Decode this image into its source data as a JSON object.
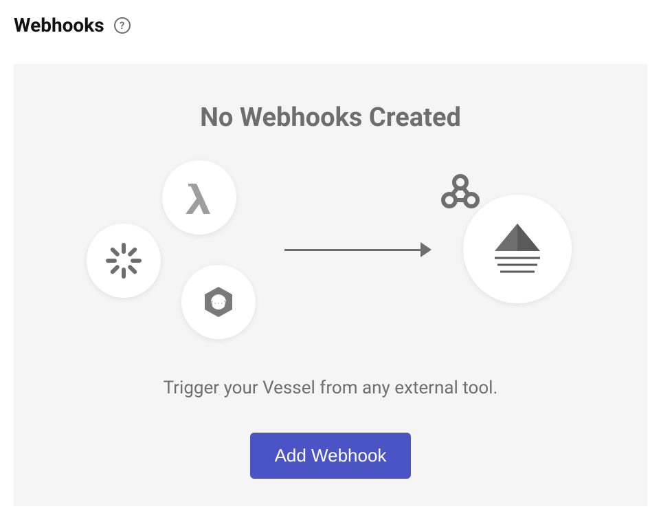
{
  "header": {
    "title": "Webhooks",
    "help_symbol": "?"
  },
  "emptyState": {
    "title": "No Webhooks Created",
    "description": "Trigger your Vessel from any external tool.",
    "button_label": "Add Webhook"
  },
  "icons": {
    "lambda": "lambda-icon",
    "zapier": "zapier-icon",
    "gcloud": "gcloud-functions-icon",
    "webhook": "webhook-icon",
    "vessel": "vessel-icon"
  },
  "colors": {
    "accent": "#4a54c5",
    "muted": "#6e6e6e",
    "panel_bg": "#f5f5f5"
  }
}
